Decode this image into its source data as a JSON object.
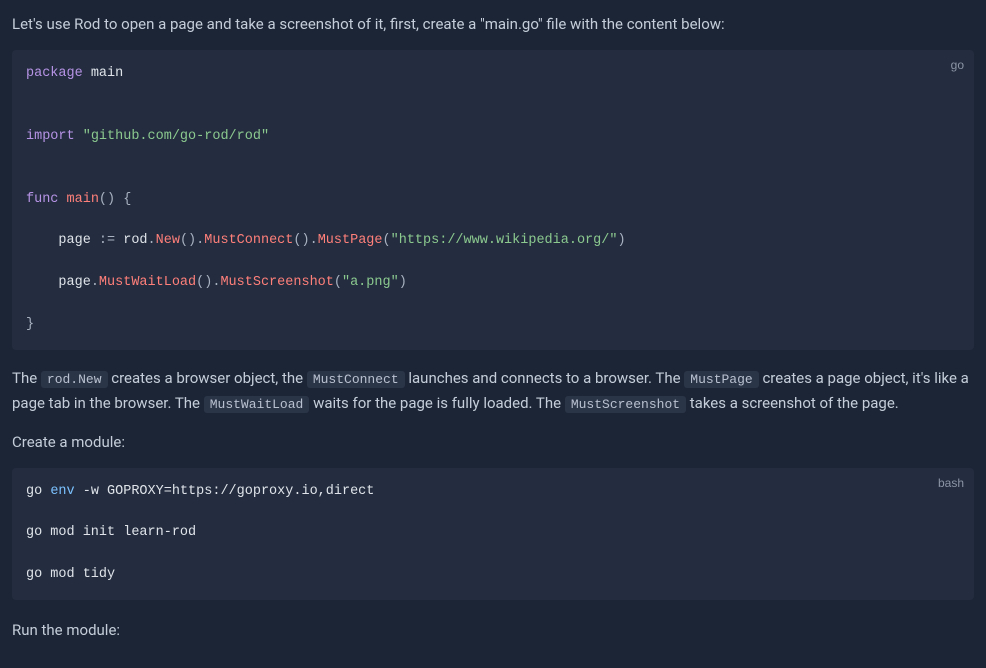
{
  "para1": "Let's use Rod to open a page and take a screenshot of it, first, create a \"main.go\" file with the content below:",
  "code1": {
    "lang": "go",
    "l1_kw": "package",
    "l1_pkg": "main",
    "l3_kw": "import",
    "l3_str": "\"github.com/go-rod/rod\"",
    "l5_kw": "func",
    "l5_nm": "main",
    "l5_tail": "() {",
    "l6_indent": "    ",
    "l6_ident1": "page",
    "l6_op": " := ",
    "l6_ident2": "rod",
    "l6_dot1": ".",
    "l6_fn1": "New",
    "l6_p1": "().",
    "l6_fn2": "MustConnect",
    "l6_p2": "().",
    "l6_fn3": "MustPage",
    "l6_p3": "(",
    "l6_str": "\"https://www.wikipedia.org/\"",
    "l6_p4": ")",
    "l7_indent": "    ",
    "l7_ident1": "page",
    "l7_dot1": ".",
    "l7_fn1": "MustWaitLoad",
    "l7_p1": "().",
    "l7_fn2": "MustScreenshot",
    "l7_p2": "(",
    "l7_str": "\"a.png\"",
    "l7_p3": ")",
    "l8": "}"
  },
  "para2": {
    "t1": "The ",
    "c1": "rod.New",
    "t2": " creates a browser object, the ",
    "c2": "MustConnect",
    "t3": " launches and connects to a browser. The ",
    "c3": "MustPage",
    "t4": " creates a page object, it's like a page tab in the browser. The ",
    "c4": "MustWaitLoad",
    "t5": " waits for the page is fully loaded. The ",
    "c5": "MustScreenshot",
    "t6": " takes a screenshot of the page."
  },
  "para3": "Create a module:",
  "code2": {
    "lang": "bash",
    "l1_a": "go ",
    "l1_env": "env",
    "l1_b": " -w GOPROXY=https://goproxy.io,direct",
    "l2": "go mod init learn-rod",
    "l3": "go mod tidy"
  },
  "para4": "Run the module:"
}
